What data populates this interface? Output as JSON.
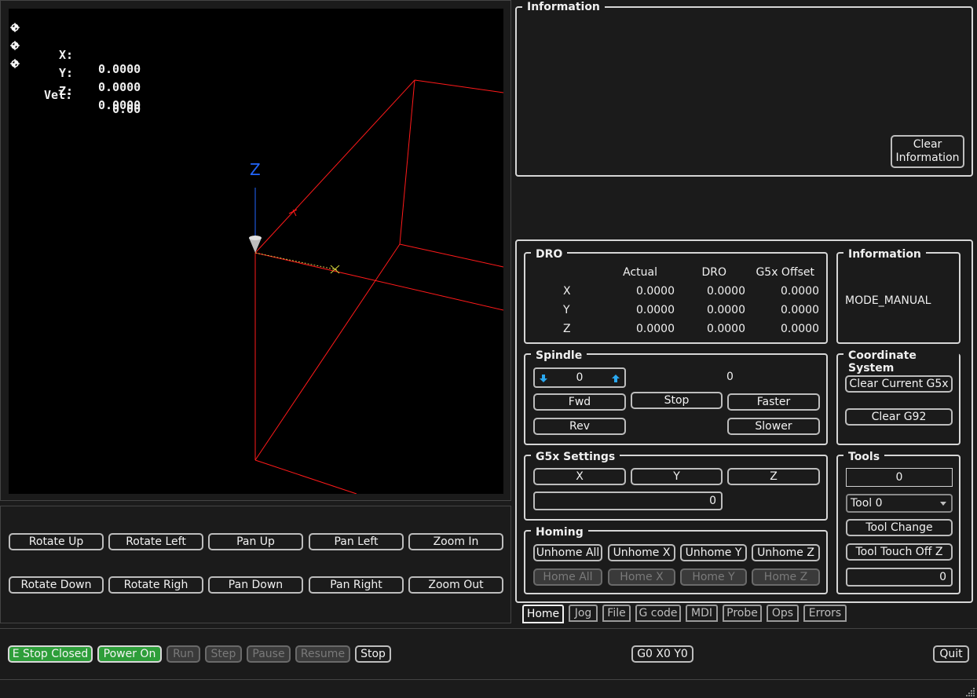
{
  "viewport": {
    "dro": {
      "x_label": "X:",
      "x_value": "0.0000",
      "y_label": "Y:",
      "y_value": "0.0000",
      "z_label": "Z:",
      "z_value": "0.0000",
      "vel_label": "Vel:",
      "vel_value": "0.00"
    },
    "axis_z_label": "Z"
  },
  "view_buttons": {
    "rotate_up": "Rotate Up",
    "rotate_left": "Rotate Left",
    "pan_up": "Pan Up",
    "pan_left": "Pan Left",
    "zoom_in": "Zoom In",
    "rotate_down": "Rotate Down",
    "rotate_right": "Rotate Righ",
    "pan_down": "Pan Down",
    "pan_right": "Pan Right",
    "zoom_out": "Zoom Out"
  },
  "info_top": {
    "title": "Information",
    "clear_line1": "Clear",
    "clear_line2": "Information"
  },
  "dro": {
    "title": "DRO",
    "headers": [
      "Actual",
      "DRO",
      "G5x Offset"
    ],
    "rows": [
      {
        "axis": "X",
        "actual": "0.0000",
        "dro": "0.0000",
        "offset": "0.0000"
      },
      {
        "axis": "Y",
        "actual": "0.0000",
        "dro": "0.0000",
        "offset": "0.0000"
      },
      {
        "axis": "Z",
        "actual": "0.0000",
        "dro": "0.0000",
        "offset": "0.0000"
      }
    ]
  },
  "info_mode": {
    "title": "Information",
    "mode": "MODE_MANUAL"
  },
  "spindle": {
    "title": "Spindle",
    "speed_value": "0",
    "speed_display": "0",
    "fwd": "Fwd",
    "stop": "Stop",
    "faster": "Faster",
    "rev": "Rev",
    "slower": "Slower"
  },
  "coord": {
    "title": "Coordinate System",
    "clear_g5x": "Clear Current G5x",
    "clear_g92": "Clear G92"
  },
  "g5x": {
    "title": "G5x Settings",
    "x": "X",
    "y": "Y",
    "z": "Z",
    "value": "0"
  },
  "tools": {
    "title": "Tools",
    "tool_number": "0",
    "tool_select": "Tool 0",
    "tool_change": "Tool Change",
    "touch_off": "Tool Touch Off Z",
    "touch_value": "0"
  },
  "homing": {
    "title": "Homing",
    "unhome_all": "Unhome All",
    "unhome_x": "Unhome X",
    "unhome_y": "Unhome Y",
    "unhome_z": "Unhome Z",
    "home_all": "Home All",
    "home_x": "Home X",
    "home_y": "Home Y",
    "home_z": "Home Z"
  },
  "tabs": [
    "Home",
    "Jog",
    "File",
    "G code",
    "MDI",
    "Probe",
    "Ops",
    "Errors"
  ],
  "statusbar": {
    "estop": "E Stop Closed",
    "power": "Power On",
    "run": "Run",
    "step": "Step",
    "pause": "Pause",
    "resume": "Resume",
    "stop": "Stop",
    "gcode": "G0 X0 Y0",
    "quit": "Quit"
  },
  "colors": {
    "viewport_bg": "#000000",
    "toolpath": "#ff1a1a",
    "axis_z": "#2266ff",
    "green_button": "#2e9e3a",
    "spin_arrow": "#2aa8f0"
  }
}
